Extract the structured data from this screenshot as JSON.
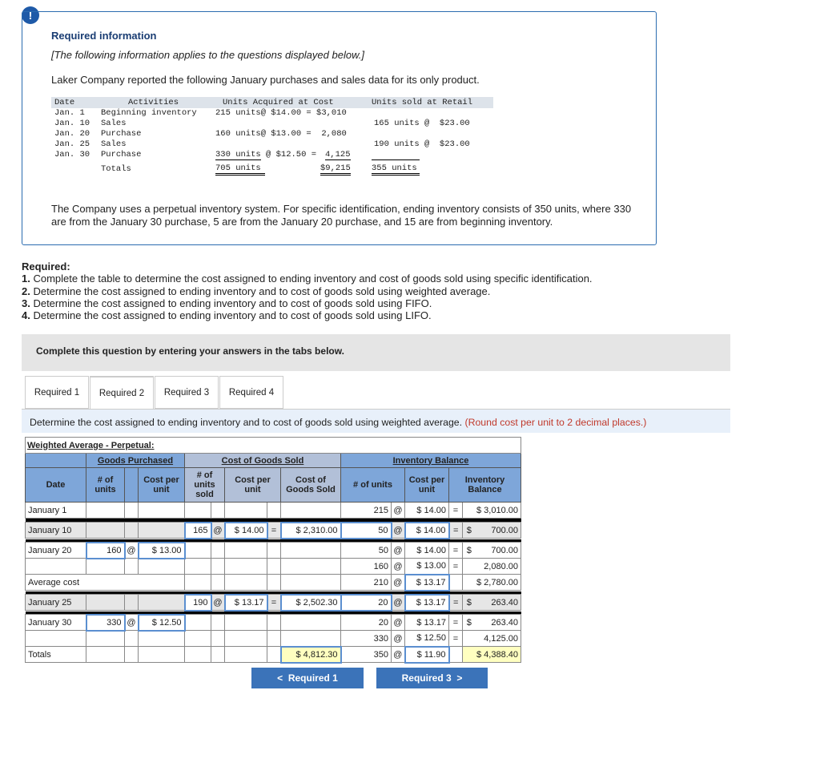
{
  "alert_icon": "!",
  "info": {
    "heading": "Required information",
    "italic": "[The following information applies to the questions displayed below.]",
    "intro": "Laker Company reported the following January purchases and sales data for its only product.",
    "table_header": {
      "date": "Date",
      "activities": "Activities",
      "acquired": "Units Acquired at Cost",
      "sold": "Units sold at Retail"
    },
    "rows": [
      {
        "date": "Jan. 1",
        "activity": "Beginning inventory",
        "acq": "215 units@ $14.00 = $3,010",
        "sold": ""
      },
      {
        "date": "Jan. 10",
        "activity": "Sales",
        "acq": "",
        "sold": "165 units @  $23.00"
      },
      {
        "date": "Jan. 20",
        "activity": "Purchase",
        "acq": "160 units@ $13.00 =  2,080",
        "sold": ""
      },
      {
        "date": "Jan. 25",
        "activity": "Sales",
        "acq": "",
        "sold": "190 units @  $23.00"
      },
      {
        "date": "Jan. 30",
        "activity": "Purchase",
        "acq_units": "330 units",
        "acq_mid": "@ $12.50 =",
        "acq_total": "4,125",
        "sold": ""
      }
    ],
    "totals": {
      "label": "Totals",
      "units": "705 units",
      "cost": "$9,215",
      "sold": "355 units"
    },
    "note": "The Company uses a perpetual inventory system. For specific identification, ending inventory consists of 350 units, where 330 are from the January 30 purchase, 5 are from the January 20 purchase, and 15 are from beginning inventory."
  },
  "required": {
    "heading": "Required:",
    "items": [
      {
        "num": "1.",
        "text": " Complete the table to determine the cost assigned to ending inventory and cost of goods sold using specific identification."
      },
      {
        "num": "2.",
        "text": " Determine the cost assigned to ending inventory and to cost of goods sold using weighted average."
      },
      {
        "num": "3.",
        "text": " Determine the cost assigned to ending inventory and to cost of goods sold using FIFO."
      },
      {
        "num": "4.",
        "text": " Determine the cost assigned to ending inventory and to cost of goods sold using LIFO."
      }
    ]
  },
  "complete_prompt": "Complete this question by entering your answers in the tabs below.",
  "tabs": [
    {
      "label": "Required 1"
    },
    {
      "label": "Required 2"
    },
    {
      "label": "Required 3"
    },
    {
      "label": "Required 4"
    }
  ],
  "active_tab": "Required 2",
  "instruction": "Determine the cost assigned to ending inventory and to cost of goods sold using weighted average.",
  "instruction_note": "(Round cost per unit to 2 decimal places.)",
  "wa": {
    "title": "Weighted Average - Perpetual:",
    "groups": {
      "purchased": "Goods Purchased",
      "cogs": "Cost of Goods Sold",
      "balance": "Inventory Balance"
    },
    "headers": {
      "date": "Date",
      "p_units": "# of units",
      "p_cost": "Cost per unit",
      "s_units": "# of units sold",
      "s_cost": "Cost per unit",
      "s_total": "Cost of Goods Sold",
      "b_units": "# of units",
      "b_cost": "Cost per unit",
      "b_total": "Inventory Balance"
    },
    "rows": [
      {
        "date": "January 1",
        "b_units": "215",
        "b_at": "@",
        "b_cost": "$ 14.00",
        "b_eq": "=",
        "b_total": "$ 3,010.00"
      },
      {
        "sep": true
      },
      {
        "date": "January 10",
        "shade": true,
        "s_units": "165",
        "s_at": "@",
        "s_cost": "$ 14.00",
        "s_eq": "=",
        "s_total": "$ 2,310.00",
        "b_units": "50",
        "b_at": "@",
        "b_cost": "$ 14.00",
        "b_eq": "=",
        "b_total": "$        700.00"
      },
      {
        "sep": true
      },
      {
        "date": "January 20",
        "p_units": "160",
        "p_at": "@",
        "p_cost": "$ 13.00",
        "b_units": "50",
        "b_at": "@",
        "b_cost": "$ 14.00",
        "b_eq": "=",
        "b_total": "$        700.00"
      },
      {
        "date": "",
        "b_units": "160",
        "b_at": "@",
        "b_cost": "$ 13.00",
        "b_eq": "=",
        "b_total": "2,080.00"
      },
      {
        "date": "Average cost",
        "span": true,
        "b_units": "210",
        "b_at": "@",
        "b_cost": "$ 13.17",
        "b_total": "$ 2,780.00"
      },
      {
        "sep": true
      },
      {
        "date": "January 25",
        "shade": true,
        "s_units": "190",
        "s_at": "@",
        "s_cost": "$ 13.17",
        "s_eq": "=",
        "s_total": "$ 2,502.30",
        "b_units": "20",
        "b_at": "@",
        "b_cost": "$ 13.17",
        "b_eq": "=",
        "b_total": "$        263.40"
      },
      {
        "sep": true
      },
      {
        "date": "January 30",
        "p_units": "330",
        "p_at": "@",
        "p_cost": "$ 12.50",
        "b_units": "20",
        "b_at": "@",
        "b_cost": "$ 13.17",
        "b_eq": "=",
        "b_total": "$        263.40"
      },
      {
        "date": "",
        "b_units": "330",
        "b_at": "@",
        "b_cost": "$ 12.50",
        "b_eq": "=",
        "b_total": "4,125.00"
      },
      {
        "date": "Totals",
        "totals": true,
        "s_total": "$ 4,812.30",
        "b_units": "350",
        "b_at": "@",
        "b_cost": "$ 11.90",
        "b_total": "$ 4,388.40"
      }
    ]
  },
  "nav": {
    "prev": "Required 1",
    "next": "Required 3"
  },
  "colors": {
    "accent": "#3b73b9",
    "header_blue": "#7ea6d9",
    "cogs_header": "#b2c0d8",
    "total_highlight": "#ffffc0"
  }
}
